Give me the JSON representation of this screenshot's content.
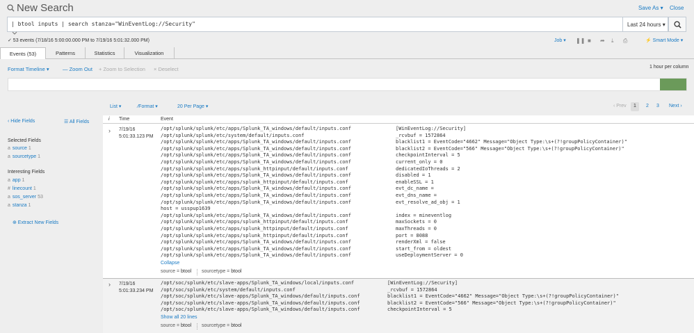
{
  "header": {
    "title": "New Search",
    "save_as": "Save As ▾",
    "close": "Close"
  },
  "search": {
    "query": "| btool inputs | search stanza=\"WinEventLog://Security\"",
    "time_range": "Last 24 hours ▾"
  },
  "status": {
    "events": "✓ 53 events (7/18/16 5:00:00.000 PM to 7/19/16 5:01:32.000 PM)",
    "job": "Job ▾",
    "mode": "⚡ Smart Mode ▾"
  },
  "tabs": [
    "Events (53)",
    "Patterns",
    "Statistics",
    "Visualization"
  ],
  "timeline": {
    "format": "Format Timeline ▾",
    "zoom_out": "— Zoom Out",
    "zoom_selection": "+ Zoom to Selection",
    "deselect": "× Deselect",
    "per_column": "1 hour per column",
    "bucket_fraction": 1.0
  },
  "results_toolbar": {
    "list": "List ▾",
    "format": "⁄Format ▾",
    "per_page": "20 Per Page ▾",
    "prev": "‹ Prev",
    "pages": [
      "1",
      "2",
      "3"
    ],
    "next": "Next ›"
  },
  "sidebar": {
    "hide_fields": "‹ Hide Fields",
    "all_fields": "☰ All Fields",
    "selected_heading": "Selected Fields",
    "selected": [
      {
        "type": "a",
        "name": "source",
        "count": "1"
      },
      {
        "type": "a",
        "name": "sourcetype",
        "count": "1"
      }
    ],
    "interesting_heading": "Interesting Fields",
    "interesting": [
      {
        "type": "a",
        "name": "app",
        "count": "1"
      },
      {
        "type": "#",
        "name": "linecount",
        "count": "1"
      },
      {
        "type": "a",
        "name": "sos_server",
        "count": "53"
      },
      {
        "type": "a",
        "name": "stanza",
        "count": "1"
      }
    ],
    "extract": "⊕ Extract New Fields"
  },
  "results": {
    "col_i": "i",
    "col_time": "Time",
    "col_event": "Event",
    "events": [
      {
        "date": "7/19/16",
        "time": "5:01:33.123 PM",
        "lines": [
          [
            "/opt/splunk/splunk/etc/apps/Splunk_TA_windows/default/inputs.conf",
            "[WinEventLog://Security]"
          ],
          [
            "/opt/splunk/splunk/etc/system/default/inputs.conf",
            "_rcvbuf = 1572864"
          ],
          [
            "/opt/splunk/splunk/etc/apps/Splunk_TA_windows/default/inputs.conf",
            "blacklist1 = EventCode=\"4662\" Message=\"Object Type:\\s+(?!groupPolicyContainer)\""
          ],
          [
            "/opt/splunk/splunk/etc/apps/Splunk_TA_windows/default/inputs.conf",
            "blacklist2 = EventCode=\"566\" Message=\"Object Type:\\s+(?!groupPolicyContainer)\""
          ],
          [
            "/opt/splunk/splunk/etc/apps/Splunk_TA_windows/default/inputs.conf",
            "checkpointInterval = 5"
          ],
          [
            "/opt/splunk/splunk/etc/apps/Splunk_TA_windows/default/inputs.conf",
            "current_only = 0"
          ],
          [
            "/opt/splunk/splunk/etc/apps/splunk_httpinput/default/inputs.conf",
            "dedicatedIoThreads = 2"
          ],
          [
            "/opt/splunk/splunk/etc/apps/Splunk_TA_windows/default/inputs.conf",
            "disabled = 1"
          ],
          [
            "/opt/splunk/splunk/etc/apps/splunk_httpinput/default/inputs.conf",
            "enableSSL = 1"
          ],
          [
            "/opt/splunk/splunk/etc/apps/Splunk_TA_windows/default/inputs.conf",
            "evt_dc_name ="
          ],
          [
            "/opt/splunk/splunk/etc/apps/Splunk_TA_windows/default/inputs.conf",
            "evt_dns_name ="
          ],
          [
            "/opt/splunk/splunk/etc/apps/Splunk_TA_windows/default/inputs.conf",
            "evt_resolve_ad_obj = 1"
          ],
          [
            "host = usspup1639",
            ""
          ],
          [
            "/opt/splunk/splunk/etc/apps/Splunk_TA_windows/default/inputs.conf",
            "index = mineventlog"
          ],
          [
            "/opt/splunk/splunk/etc/apps/splunk_httpinput/default/inputs.conf",
            "maxSockets = 0"
          ],
          [
            "/opt/splunk/splunk/etc/apps/splunk_httpinput/default/inputs.conf",
            "maxThreads = 0"
          ],
          [
            "/opt/splunk/splunk/etc/apps/splunk_httpinput/default/inputs.conf",
            "port = 8088"
          ],
          [
            "/opt/splunk/splunk/etc/apps/Splunk_TA_windows/default/inputs.conf",
            "renderXml = false"
          ],
          [
            "/opt/splunk/splunk/etc/apps/Splunk_TA_windows/default/inputs.conf",
            "start_from = oldest"
          ],
          [
            "/opt/splunk/splunk/etc/apps/Splunk_TA_windows/default/inputs.conf",
            "useDeploymentServer = 0"
          ]
        ],
        "toggle": "Collapse",
        "source_label": "source = ",
        "source": "btool",
        "sourcetype_label": "sourcetype = ",
        "sourcetype": "btool"
      },
      {
        "date": "7/19/16",
        "time": "5:01:33.234 PM",
        "lines": [
          [
            "/opt/soc/splunk/etc/slave-apps/Splunk_TA_windows/local/inputs.conf",
            "[WinEventLog://Security]"
          ],
          [
            "/opt/soc/splunk/etc/system/default/inputs.conf",
            "_rcvbuf = 1572864"
          ],
          [
            "/opt/soc/splunk/etc/slave-apps/Splunk_TA_windows/default/inputs.conf",
            "blacklist1 = EventCode=\"4662\" Message=\"Object Type:\\s+(?!groupPolicyContainer)\""
          ],
          [
            "/opt/soc/splunk/etc/slave-apps/Splunk_TA_windows/default/inputs.conf",
            "blacklist2 = EventCode=\"566\" Message=\"Object Type:\\s+(?!groupPolicyContainer)\""
          ],
          [
            "/opt/soc/splunk/etc/slave-apps/Splunk_TA_windows/default/inputs.conf",
            "checkpointInterval = 5"
          ]
        ],
        "toggle": "Show all 20 lines",
        "source_label": "source = ",
        "source": "btool",
        "sourcetype_label": "sourcetype = ",
        "sourcetype": "btool"
      }
    ]
  },
  "colors": {
    "link": "#1a7bc4",
    "timeline_bar": "#6b9a5a"
  }
}
